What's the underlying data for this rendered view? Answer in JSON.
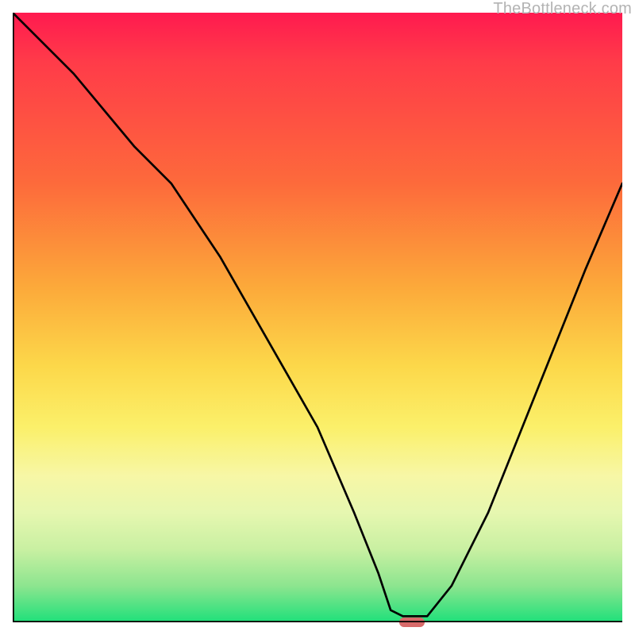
{
  "watermark": {
    "text": "TheBottleneck.com"
  },
  "colors": {
    "axis": "#000000",
    "curve": "#000000",
    "marker": "#d86a6a"
  },
  "chart_data": {
    "type": "line",
    "title": "",
    "xlabel": "",
    "ylabel": "",
    "xlim": [
      0,
      100
    ],
    "ylim": [
      0,
      100
    ],
    "x": [
      0,
      10,
      20,
      26,
      34,
      42,
      50,
      56,
      60,
      62,
      64,
      68,
      72,
      78,
      86,
      94,
      100
    ],
    "values": [
      100,
      90,
      78,
      72,
      60,
      46,
      32,
      18,
      8,
      2,
      1,
      1,
      6,
      18,
      38,
      58,
      72
    ],
    "marker": {
      "x": 65.5,
      "y": 0
    },
    "grid": false,
    "legend": false
  }
}
